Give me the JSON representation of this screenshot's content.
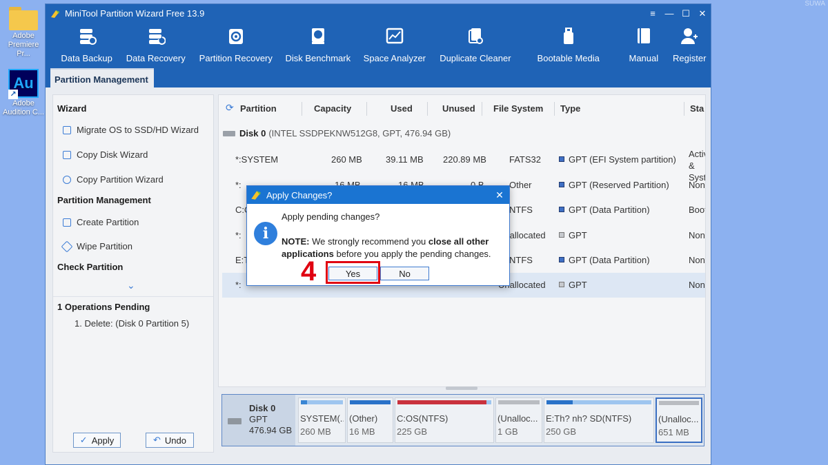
{
  "desktop": {
    "icons": [
      {
        "label": "Adobe Premiere Pr..."
      },
      {
        "label": "Adobe Audition C..."
      }
    ],
    "watermark": "SUWA"
  },
  "window": {
    "title": "MiniTool Partition Wizard Free 13.9",
    "controls": [
      "≡",
      "—",
      "☐",
      "✕"
    ],
    "toolbar": [
      {
        "label": "Data Backup",
        "icon": "data-backup-icon"
      },
      {
        "label": "Data Recovery",
        "icon": "data-recovery-icon"
      },
      {
        "label": "Partition Recovery",
        "icon": "partition-recovery-icon"
      },
      {
        "label": "Disk Benchmark",
        "icon": "disk-benchmark-icon"
      },
      {
        "label": "Space Analyzer",
        "icon": "space-analyzer-icon"
      },
      {
        "label": "Duplicate Cleaner",
        "icon": "duplicate-cleaner-icon"
      },
      {
        "label": "Bootable Media",
        "icon": "bootable-media-icon"
      },
      {
        "label": "Manual",
        "icon": "manual-icon"
      },
      {
        "label": "Register",
        "icon": "register-icon"
      }
    ],
    "active_tab": "Partition Management"
  },
  "sidebar": {
    "wizard_heading": "Wizard",
    "wizard_items": [
      "Migrate OS to SSD/HD Wizard",
      "Copy Disk Wizard",
      "Copy Partition Wizard"
    ],
    "pm_heading": "Partition Management",
    "pm_items": [
      "Create Partition",
      "Wipe Partition"
    ],
    "check_heading": "Check Partition",
    "expand_glyph": "⌄",
    "pending_heading": "1 Operations Pending",
    "pending_items": [
      "1. Delete: (Disk 0 Partition 5)"
    ],
    "apply_label": "Apply",
    "undo_label": "Undo"
  },
  "table": {
    "columns": [
      "Partition",
      "Capacity",
      "Used",
      "Unused",
      "File System",
      "Type",
      "Sta"
    ],
    "disk_label": "Disk 0",
    "disk_detail": "(INTEL SSDPEKNW512G8, GPT, 476.94 GB)",
    "rows": [
      {
        "partition": "*:SYSTEM",
        "capacity": "260 MB",
        "used": "39.11 MB",
        "unused": "220.89 MB",
        "fs": "FATS32",
        "type": "GPT (EFI System partition)",
        "status": "Active & System"
      },
      {
        "partition": "*:",
        "capacity": "16 MB",
        "used": "16 MB",
        "unused": "0 B",
        "fs": "Other",
        "type": "GPT (Reserved Partition)",
        "status": "None"
      },
      {
        "partition": "C:O",
        "capacity": "",
        "used": "",
        "unused": "",
        "fs": "NTFS",
        "type": "GPT (Data Partition)",
        "status": "Boot"
      },
      {
        "partition": "*:",
        "capacity": "",
        "used": "",
        "unused": "",
        "fs": "Unallocated",
        "type": "GPT",
        "status": "None"
      },
      {
        "partition": "E:T",
        "capacity": "",
        "used": "",
        "unused": "",
        "fs": "NTFS",
        "type": "GPT (Data Partition)",
        "status": "None"
      },
      {
        "partition": "*:",
        "capacity": "",
        "used": "",
        "unused": "",
        "fs": "Unallocated",
        "type": "GPT",
        "status": "None"
      }
    ]
  },
  "diskmap": {
    "disk": "Disk 0",
    "scheme": "GPT",
    "size": "476.94 GB",
    "partitions": [
      {
        "name": "SYSTEM(...",
        "size": "260 MB",
        "color": "#3a86d4",
        "fill": 0.15
      },
      {
        "name": "(Other)",
        "size": "16 MB",
        "color": "#2a72c8",
        "fill": 1.0
      },
      {
        "name": "C:OS(NTFS)",
        "size": "225 GB",
        "color": "#c9323d",
        "fill": 0.95
      },
      {
        "name": "(Unalloc...",
        "size": "1 GB",
        "color": "#b9bcc1",
        "fill": 1.0
      },
      {
        "name": "E:Th? nh? SD(NTFS)",
        "size": "250 GB",
        "color": "#2a72c8",
        "fill": 0.25
      },
      {
        "name": "(Unalloc...",
        "size": "651 MB",
        "color": "#b9bcc1",
        "fill": 1.0
      }
    ]
  },
  "dialog": {
    "title": "Apply Changes?",
    "question": "Apply pending changes?",
    "note_label": "NOTE:",
    "note_text1": " We strongly recommend you ",
    "note_bold": "close all other applications",
    "note_text2": " before you apply the pending changes.",
    "yes_label": "Yes",
    "no_label": "No",
    "close_glyph": "✕",
    "info_glyph": "i"
  },
  "annotation": {
    "step": "4",
    "color": "#e00010"
  }
}
